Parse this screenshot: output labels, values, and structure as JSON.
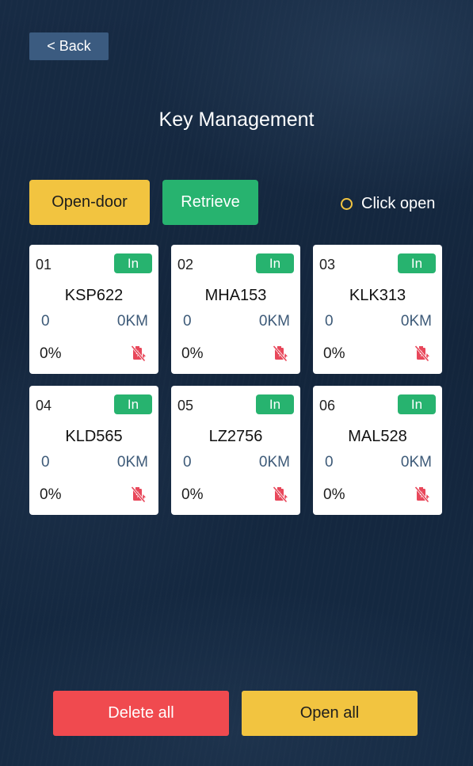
{
  "header": {
    "back_label": "< Back",
    "title": "Key Management"
  },
  "toolbar": {
    "open_door_label": "Open-door",
    "retrieve_label": "Retrieve",
    "click_open_label": "Click open"
  },
  "keys": [
    {
      "slot": "01",
      "status": "In",
      "plate": "KSP622",
      "count": "0",
      "distance": "0KM",
      "battery": "0%"
    },
    {
      "slot": "02",
      "status": "In",
      "plate": "MHA153",
      "count": "0",
      "distance": "0KM",
      "battery": "0%"
    },
    {
      "slot": "03",
      "status": "In",
      "plate": "KLK313",
      "count": "0",
      "distance": "0KM",
      "battery": "0%"
    },
    {
      "slot": "04",
      "status": "In",
      "plate": "KLD565",
      "count": "0",
      "distance": "0KM",
      "battery": "0%"
    },
    {
      "slot": "05",
      "status": "In",
      "plate": "LZ2756",
      "count": "0",
      "distance": "0KM",
      "battery": "0%"
    },
    {
      "slot": "06",
      "status": "In",
      "plate": "MAL528",
      "count": "0",
      "distance": "0KM",
      "battery": "0%"
    }
  ],
  "footer": {
    "delete_all_label": "Delete all",
    "open_all_label": "Open all"
  },
  "icons": {
    "charge": "no-charging-icon"
  },
  "colors": {
    "accent_yellow": "#f2c440",
    "accent_green": "#27b36f",
    "danger_red": "#f04a4f",
    "back_button": "#3b5b80",
    "charge_icon": "#e8475a"
  }
}
